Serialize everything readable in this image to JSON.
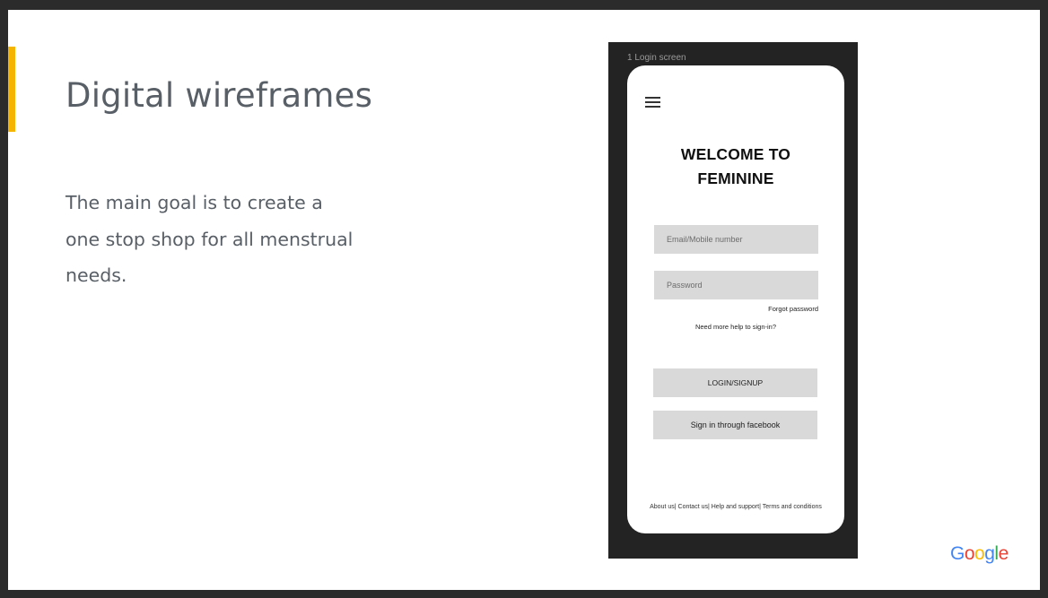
{
  "slide": {
    "title": "Digital wireframes",
    "body": "The main goal is to create a one stop shop for all menstrual needs."
  },
  "wireframe": {
    "frame_label": "1 Login screen",
    "welcome": "WELCOME TO FEMININE",
    "email_placeholder": "Email/Mobile number",
    "password_placeholder": "Password",
    "forgot_password": "Forgot password",
    "help_link": "Need more help to sign-in?",
    "login_button": "LOGIN/SIGNUP",
    "facebook_button": "Sign in through facebook",
    "footer_links": [
      "About us|",
      "Contact us|",
      "Help and support|",
      "Terms and conditions"
    ]
  },
  "branding": {
    "logo_letters": [
      "G",
      "o",
      "o",
      "g",
      "l",
      "e"
    ],
    "logo_colors": [
      "#4285F4",
      "#EA4335",
      "#FBBC05",
      "#4285F4",
      "#34A853",
      "#EA4335"
    ],
    "accent_color": "#f4b400"
  },
  "icons": {
    "menu": "hamburger-menu-icon"
  }
}
